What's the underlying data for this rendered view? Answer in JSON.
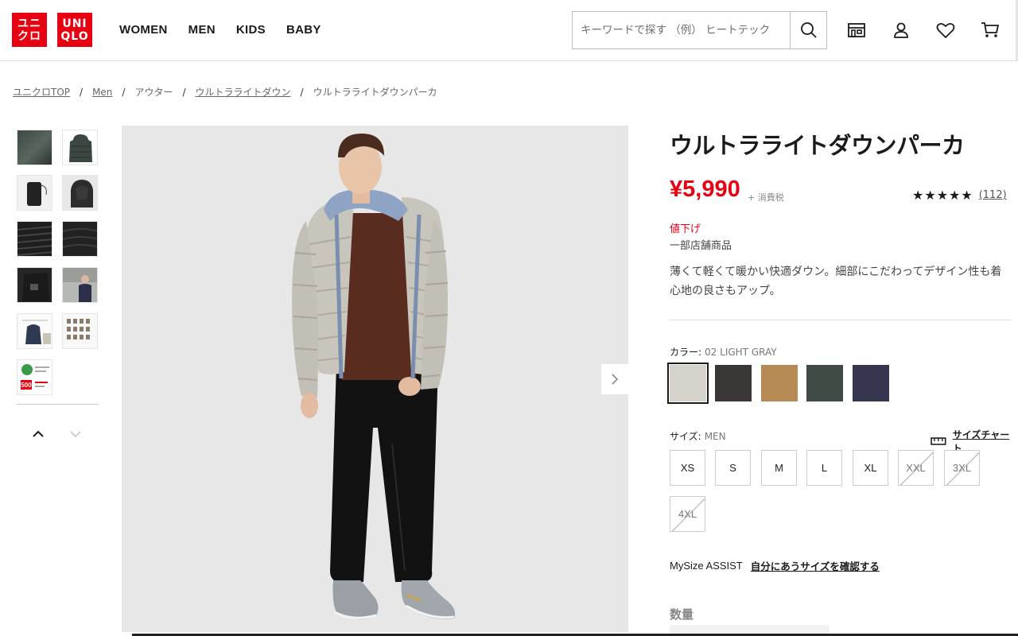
{
  "header": {
    "logo_top": "ユニ\nクロ",
    "logo_top_l1": "ユニ",
    "logo_top_l2": "クロ",
    "logo_en_l1": "UNI",
    "logo_en_l2": "QLO",
    "nav": [
      "WOMEN",
      "MEN",
      "KIDS",
      "BABY"
    ],
    "search_placeholder": "キーワードで探す （例） ヒートテック",
    "icons": [
      "store-icon",
      "account-icon",
      "heart-icon",
      "cart-icon"
    ]
  },
  "breadcrumb": [
    {
      "label": "ユニクロTOP",
      "link": true
    },
    {
      "label": "Men",
      "link": true
    },
    {
      "label": "アウター",
      "link": false
    },
    {
      "label": "ウルトラライトダウン",
      "link": true
    },
    {
      "label": "ウルトラライトダウンパーカ",
      "link": false
    }
  ],
  "product": {
    "title": "ウルトラライトダウンパーカ",
    "price": "¥5,990",
    "tax": "+ 消費税",
    "rating_stars": "★★★★★",
    "review_count": "(112)",
    "sale_tag": "値下げ",
    "store_only": "一部店舗商品",
    "description": "薄くて軽くて暖かい快適ダウン。細部にこだわってデザイン性も着心地の良さもアップ。",
    "color_label": "カラー:",
    "color_value": "02 LIGHT GRAY",
    "colors": [
      "#d5d1cb",
      "#3a3636",
      "#b58a55",
      "#3f4a45",
      "#363650"
    ],
    "size_label": "サイズ:",
    "size_value": "MEN",
    "size_chart": "サイズチャート",
    "sizes": [
      {
        "label": "XS",
        "available": true
      },
      {
        "label": "S",
        "available": true
      },
      {
        "label": "M",
        "available": true
      },
      {
        "label": "L",
        "available": true
      },
      {
        "label": "XL",
        "available": true
      },
      {
        "label": "XXL",
        "available": false
      },
      {
        "label": "3XL",
        "available": false
      },
      {
        "label": "4XL",
        "available": false
      }
    ],
    "mysize_label": "MySize ASSIST",
    "mysize_link": "自分にあうサイズを確認する",
    "quantity_label": "数量"
  },
  "thumbnail_banner_text": "500"
}
